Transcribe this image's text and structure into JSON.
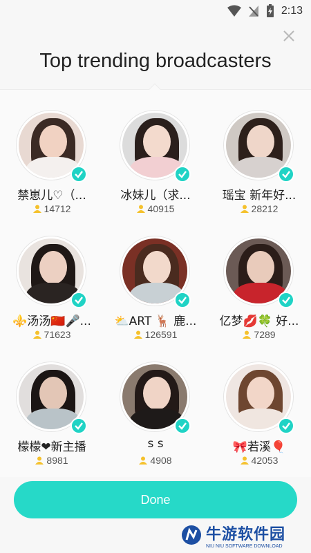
{
  "status_bar": {
    "time": "2:13"
  },
  "header": {
    "title": "Top trending broadcasters"
  },
  "broadcasters": [
    {
      "name": "禁崽儿♡（...",
      "fans": "14712",
      "skin": "#f1d2c2",
      "hair": "#3b2a24",
      "bg": "#e8d9d2",
      "cloth": "#f4f0ee"
    },
    {
      "name": "冰妹儿（求...",
      "fans": "40915",
      "skin": "#f3dacd",
      "hair": "#2a1f1c",
      "bg": "#dcdcdc",
      "cloth": "#f2cfd2"
    },
    {
      "name": "瑶宝 新年好...",
      "fans": "28212",
      "skin": "#efd6c9",
      "hair": "#2d201b",
      "bg": "#cfc9c4",
      "cloth": "#d7d1cf"
    },
    {
      "name": "⚜️汤汤🇨🇳🎤...",
      "fans": "71623",
      "skin": "#ecd0c2",
      "hair": "#1f1816",
      "bg": "#e9e3df",
      "cloth": "#2a2422"
    },
    {
      "name": "⛅ART 🦌 鹿...",
      "fans": "126591",
      "skin": "#f2d9cb",
      "hair": "#4a2b1f",
      "bg": "#7a3025",
      "cloth": "#c8d0d4"
    },
    {
      "name": "亿梦💋🍀 好...",
      "fans": "7289",
      "skin": "#e9cbbb",
      "hair": "#2b1d19",
      "bg": "#6b5a55",
      "cloth": "#c8242c"
    },
    {
      "name": "檬檬❤新主播",
      "fans": "8981",
      "skin": "#e3c6b6",
      "hair": "#1b1514",
      "bg": "#e1dedd",
      "cloth": "#b9c3c8"
    },
    {
      "name": "s s",
      "fans": "4908",
      "skin": "#f0d4c6",
      "hair": "#231917",
      "bg": "#8a7a6e",
      "cloth": "#1e1a19"
    },
    {
      "name": "🎀若溪🎈",
      "fans": "42053",
      "skin": "#f2d6c8",
      "hair": "#6e4630",
      "bg": "#efe6e2",
      "cloth": "#f0e6e0"
    }
  ],
  "done_button": {
    "label": "Done"
  },
  "watermark": {
    "cn": "牛游软件园",
    "en": "NIU NIU SOFTWARE DOWNLOAD"
  },
  "colors": {
    "accent": "#26d9c8",
    "badge": "#20d3c5",
    "fans_icon": "#f5c12c"
  }
}
